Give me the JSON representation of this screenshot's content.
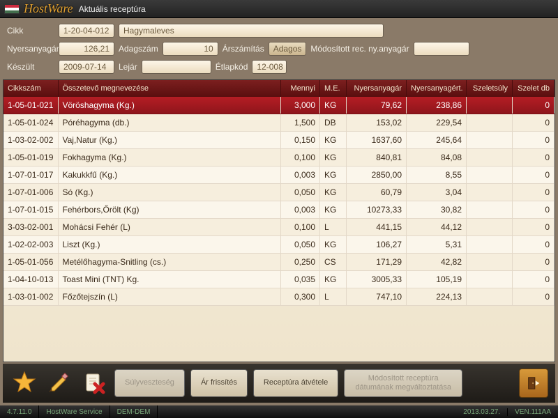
{
  "titlebar": {
    "app": "HostWare",
    "title": "Aktuális receptúra"
  },
  "form": {
    "cikk_label": "Cikk",
    "cikk_code": "1-20-04-012",
    "cikk_name": "Hagymaleves",
    "nyersanyagar_label": "Nyersanyagár",
    "nyersanyagar": "126,21",
    "adagszam_label": "Adagszám",
    "adagszam": "10",
    "arszamitas_label": "Árszámítás",
    "arszamitas_btn": "Adagos",
    "modositott_label": "Módosított rec. ny.anyagár",
    "modositott_value": "",
    "keszult_label": "Készült",
    "keszult": "2009-07-14",
    "lejar_label": "Lejár",
    "lejar": "",
    "etlapkod_label": "Étlapkód",
    "etlapkod": "12-008"
  },
  "table": {
    "headers": {
      "cikkszam": "Cikkszám",
      "osszetevo": "Összetevő megnevezése",
      "mennyi": "Mennyi",
      "me": "M.E.",
      "nyersanyagar": "Nyersanyagár",
      "nyersanyagert": "Nyersanyagért.",
      "szeletsuly": "Szeletsúly",
      "szeletdb": "Szelet db"
    },
    "rows": [
      {
        "code": "1-05-01-021",
        "name": "Vöröshagyma (Kg.)",
        "qty": "3,000",
        "unit": "KG",
        "price": "79,62",
        "value": "238,86",
        "slice_w": "",
        "slice_n": "0",
        "selected": true
      },
      {
        "code": "1-05-01-024",
        "name": "Póréhagyma (db.)",
        "qty": "1,500",
        "unit": "DB",
        "price": "153,02",
        "value": "229,54",
        "slice_w": "",
        "slice_n": "0"
      },
      {
        "code": "1-03-02-002",
        "name": "Vaj,Natur (Kg.)",
        "qty": "0,150",
        "unit": "KG",
        "price": "1637,60",
        "value": "245,64",
        "slice_w": "",
        "slice_n": "0"
      },
      {
        "code": "1-05-01-019",
        "name": "Fokhagyma (Kg.)",
        "qty": "0,100",
        "unit": "KG",
        "price": "840,81",
        "value": "84,08",
        "slice_w": "",
        "slice_n": "0"
      },
      {
        "code": "1-07-01-017",
        "name": "Kakukkfű (Kg.)",
        "qty": "0,003",
        "unit": "KG",
        "price": "2850,00",
        "value": "8,55",
        "slice_w": "",
        "slice_n": "0"
      },
      {
        "code": "1-07-01-006",
        "name": "Só (Kg.)",
        "qty": "0,050",
        "unit": "KG",
        "price": "60,79",
        "value": "3,04",
        "slice_w": "",
        "slice_n": "0"
      },
      {
        "code": "1-07-01-015",
        "name": "Fehérbors,Őrölt (Kg)",
        "qty": "0,003",
        "unit": "KG",
        "price": "10273,33",
        "value": "30,82",
        "slice_w": "",
        "slice_n": "0"
      },
      {
        "code": "3-03-02-001",
        "name": "Mohácsi Fehér (L)",
        "qty": "0,100",
        "unit": "L",
        "price": "441,15",
        "value": "44,12",
        "slice_w": "",
        "slice_n": "0"
      },
      {
        "code": "1-02-02-003",
        "name": "Liszt (Kg.)",
        "qty": "0,050",
        "unit": "KG",
        "price": "106,27",
        "value": "5,31",
        "slice_w": "",
        "slice_n": "0"
      },
      {
        "code": "1-05-01-056",
        "name": "Metélőhagyma-Snitling (cs.)",
        "qty": "0,250",
        "unit": "CS",
        "price": "171,29",
        "value": "42,82",
        "slice_w": "",
        "slice_n": "0"
      },
      {
        "code": "1-04-10-013",
        "name": "Toast Mini (TNT) Kg.",
        "qty": "0,035",
        "unit": "KG",
        "price": "3005,33",
        "value": "105,19",
        "slice_w": "",
        "slice_n": "0"
      },
      {
        "code": "1-03-01-002",
        "name": "Főzőtejszín (L)",
        "qty": "0,300",
        "unit": "L",
        "price": "747,10",
        "value": "224,13",
        "slice_w": "",
        "slice_n": "0"
      }
    ]
  },
  "footer": {
    "sulyveszteseg": "Súlyveszteség",
    "ar_frissites": "Ár frissítés",
    "receptura_atvetele": "Receptúra átvétele",
    "modositott_receptura_l1": "Módosított receptúra",
    "modositott_receptura_l2": "dátumának megváltoztatása"
  },
  "status": {
    "version": "4.7.11.0",
    "service": "HostWare Service",
    "env": "DEM-DEM",
    "date": "2013.03.27.",
    "terminal": "VEN.111AA"
  }
}
